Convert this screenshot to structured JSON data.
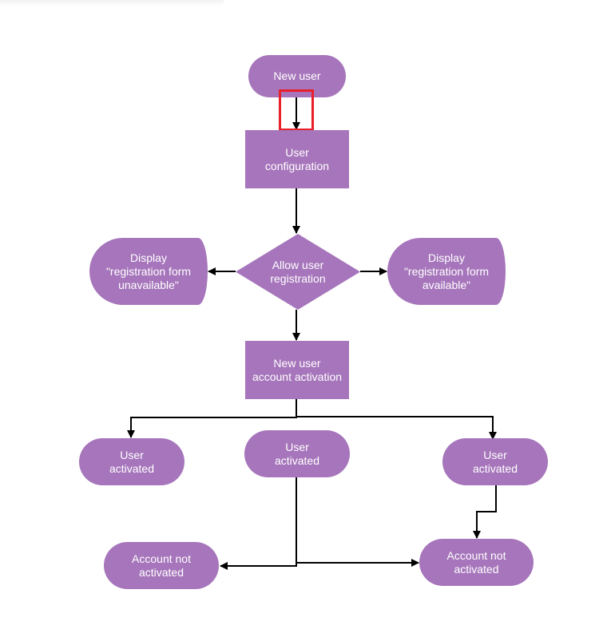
{
  "colors": {
    "node_fill": "#a675bb",
    "connector": "#000000",
    "highlight": "#e8202a"
  },
  "nodes": {
    "new_user": "New user",
    "user_configuration": "User\nconfiguration",
    "allow_registration": "Allow user\nregistration",
    "display_unavailable": "Display\n\"registration form\nunavailable\"",
    "display_available": "Display\n\"registration form\navailable\"",
    "account_activation": "New user\naccount activation",
    "user_activated_left": "User\nactivated",
    "user_activated_middle": "User\nactivated",
    "user_activated_right": "User\nactivated",
    "account_not_activated_left": "Account not\nactivated",
    "account_not_activated_right": "Account not\nactivated"
  }
}
